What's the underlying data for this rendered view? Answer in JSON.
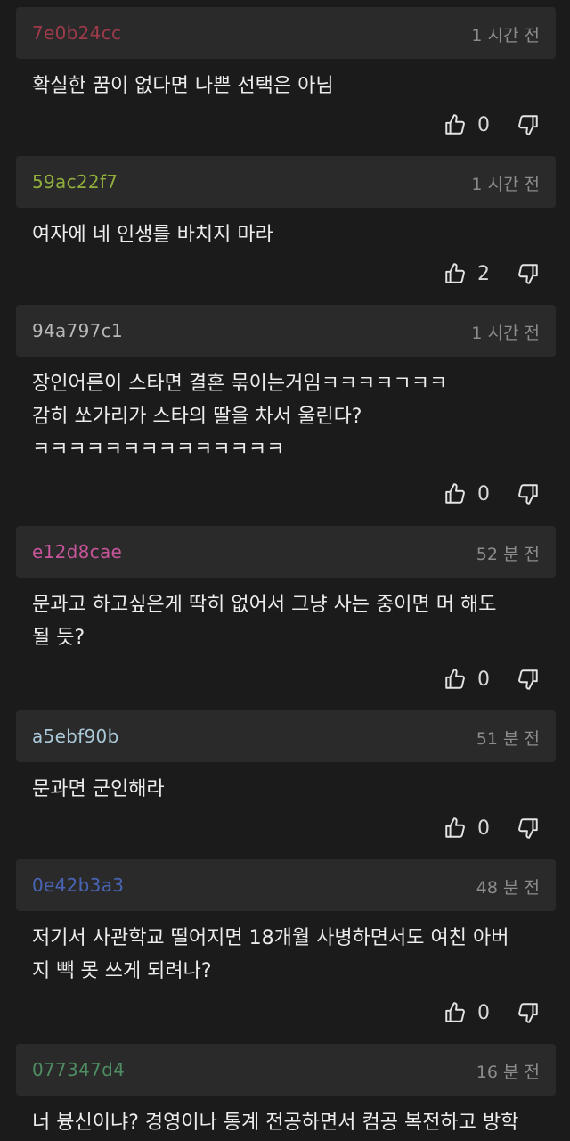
{
  "comments": [
    {
      "author": "7e0b24cc",
      "author_color": "#9e3a4a",
      "time": "1 시간 전",
      "text": "확실한 꿈이 없다면 나쁜 선택은 아님",
      "likes": "0"
    },
    {
      "author": "59ac22f7",
      "author_color": "#8fae3c",
      "time": "1 시간 전",
      "text": "여자에 네 인생를 바치지 마라",
      "likes": "2"
    },
    {
      "author": "94a797c1",
      "author_color": "#b8b8b8",
      "time": "1 시간 전",
      "text": "장인어른이 스타면 결혼 묶이는거임ㅋㅋㅋㅋㄱㅋㅋ\n감히 쏘가리가 스타의 딸을 차서 울린다?\nㅋㅋㅋㅋㅋㅋㅋㅋㅋㅋㅋㅋㅋㅋ",
      "likes": "0"
    },
    {
      "author": "e12d8cae",
      "author_color": "#c8559a",
      "time": "52 분 전",
      "text": "문과고 하고싶은게 딱히 없어서 그냥 사는 중이면 머 해도\n될 듯?",
      "likes": "0"
    },
    {
      "author": "a5ebf90b",
      "author_color": "#a9c8d8",
      "time": "51 분 전",
      "text": "문과면 군인해라",
      "likes": "0"
    },
    {
      "author": "0e42b3a3",
      "author_color": "#4a64b4",
      "time": "48 분 전",
      "text": "저기서 사관학교 떨어지면 18개월 사병하면서도 여친 아버\n지 빽 못 쓰게 되려나?",
      "likes": "0"
    },
    {
      "author": "077347d4",
      "author_color": "#4e8c62",
      "time": "16 분 전",
      "text": "너 븅신이냐? 경영이나 통계 전공하면서 컴공 복전하고 방학",
      "likes": ""
    }
  ]
}
